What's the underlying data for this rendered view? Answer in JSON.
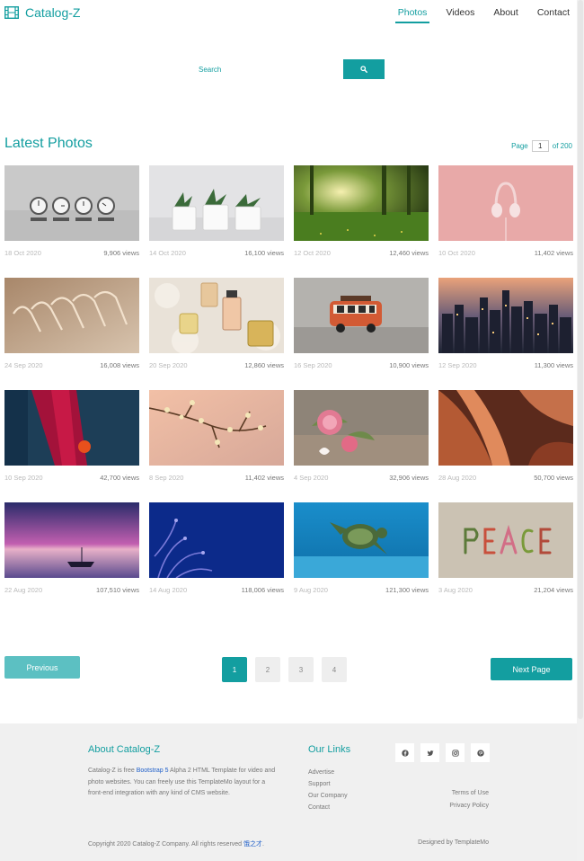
{
  "brand": {
    "name": "Catalog-Z"
  },
  "nav": [
    {
      "label": "Photos",
      "active": true
    },
    {
      "label": "Videos",
      "active": false
    },
    {
      "label": "About",
      "active": false
    },
    {
      "label": "Contact",
      "active": false
    }
  ],
  "search": {
    "placeholder": "Search",
    "value": ""
  },
  "section": {
    "title": "Latest Photos",
    "page_label": "Page",
    "page_value": "1",
    "page_total": "of 200"
  },
  "photos": [
    {
      "date": "18 Oct 2020",
      "views": "9,906 views",
      "subject": "clocks"
    },
    {
      "date": "14 Oct 2020",
      "views": "16,100 views",
      "subject": "plants"
    },
    {
      "date": "12 Oct 2020",
      "views": "12,460 views",
      "subject": "forest"
    },
    {
      "date": "10 Oct 2020",
      "views": "11,402 views",
      "subject": "headphones"
    },
    {
      "date": "24 Sep 2020",
      "views": "16,008 views",
      "subject": "hangers"
    },
    {
      "date": "20 Sep 2020",
      "views": "12,860 views",
      "subject": "perfume"
    },
    {
      "date": "16 Sep 2020",
      "views": "10,900 views",
      "subject": "toy-van"
    },
    {
      "date": "12 Sep 2020",
      "views": "11,300 views",
      "subject": "city"
    },
    {
      "date": "10 Sep 2020",
      "views": "42,700 views",
      "subject": "red-abstract"
    },
    {
      "date": "8 Sep 2020",
      "views": "11,402 views",
      "subject": "blossom"
    },
    {
      "date": "4 Sep 2020",
      "views": "32,906 views",
      "subject": "roses"
    },
    {
      "date": "28 Aug 2020",
      "views": "50,700 views",
      "subject": "canyon"
    },
    {
      "date": "22 Aug 2020",
      "views": "107,510 views",
      "subject": "sunset-boat"
    },
    {
      "date": "14 Aug 2020",
      "views": "118,006 views",
      "subject": "coral"
    },
    {
      "date": "9 Aug 2020",
      "views": "121,300 views",
      "subject": "turtle"
    },
    {
      "date": "3 Aug 2020",
      "views": "21,204 views",
      "subject": "peace"
    }
  ],
  "pagination": {
    "prev_label": "Previous",
    "next_label": "Next Page",
    "pages": [
      "1",
      "2",
      "3",
      "4"
    ],
    "current": "1"
  },
  "footer": {
    "about_title": "About Catalog-Z",
    "about_text_before": "Catalog-Z is free ",
    "about_link": "Bootstrap 5",
    "about_text_after": " Alpha 2 HTML Template for video and photo websites. You can freely use this TemplateMo layout for a front-end integration with any kind of CMS website.",
    "links_title": "Our Links",
    "links": [
      "Advertise",
      "Support",
      "Our Company",
      "Contact"
    ],
    "socials": [
      "facebook-icon",
      "twitter-icon",
      "instagram-icon",
      "pinterest-icon"
    ],
    "right_links": [
      "Terms of Use",
      "Privacy Policy"
    ],
    "copyright_before": "Copyright 2020 Catalog-Z Company. All rights reserved ",
    "copyright_link": "饿之才",
    "copyright_after": ".",
    "designed": "Designed by TemplateMo"
  },
  "colors": {
    "accent": "#139ea0",
    "accent_light": "#5cc0c2",
    "link": "#1f5fc9",
    "footer_bg": "#f0f0f0"
  }
}
